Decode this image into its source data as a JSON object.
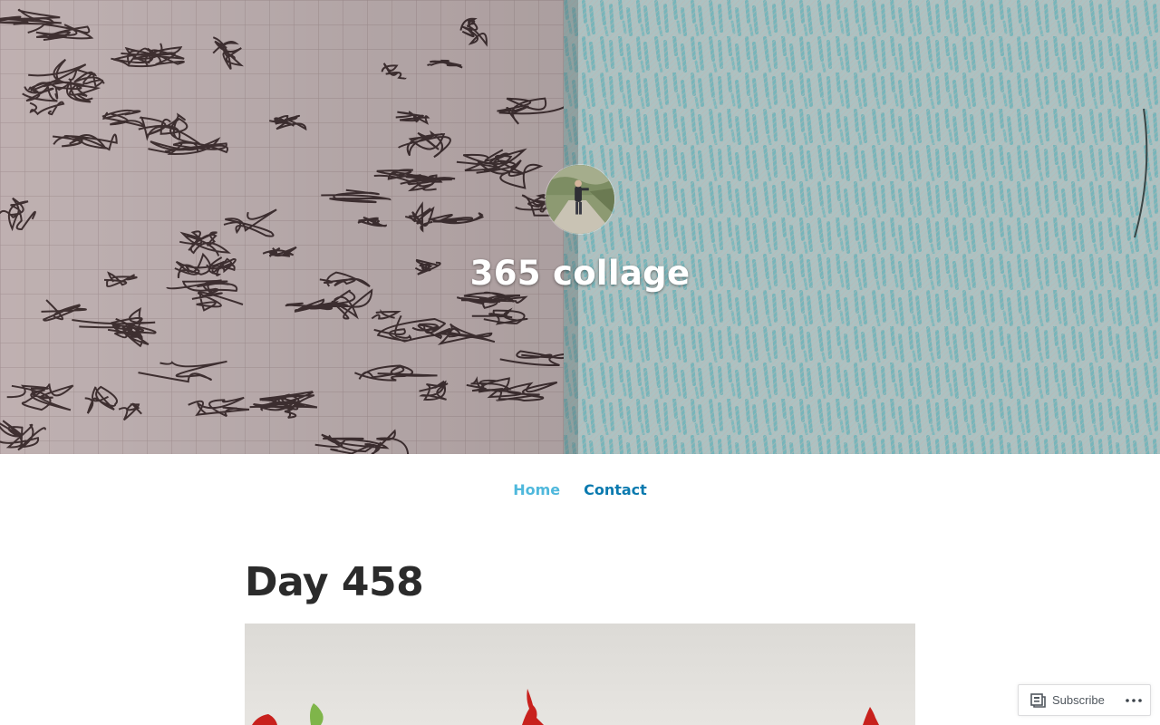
{
  "site": {
    "title": "365 collage",
    "header_image": "collage-texture-header",
    "avatar": "site-avatar-photo"
  },
  "nav": {
    "items": [
      {
        "label": "Home",
        "current": true
      },
      {
        "label": "Contact",
        "current": false
      }
    ]
  },
  "post": {
    "title": "Day 458",
    "featured_image": "collage-featured-image"
  },
  "subscribe": {
    "label": "Subscribe",
    "icon": "reader-icon",
    "more_icon": "ellipsis-icon"
  },
  "colors": {
    "nav_current": "#4fb8dc",
    "nav_link": "#0a7aaf",
    "post_title": "#2b2b2b",
    "header_left": "#d3c3c4",
    "header_right": "#9fbcbd"
  }
}
